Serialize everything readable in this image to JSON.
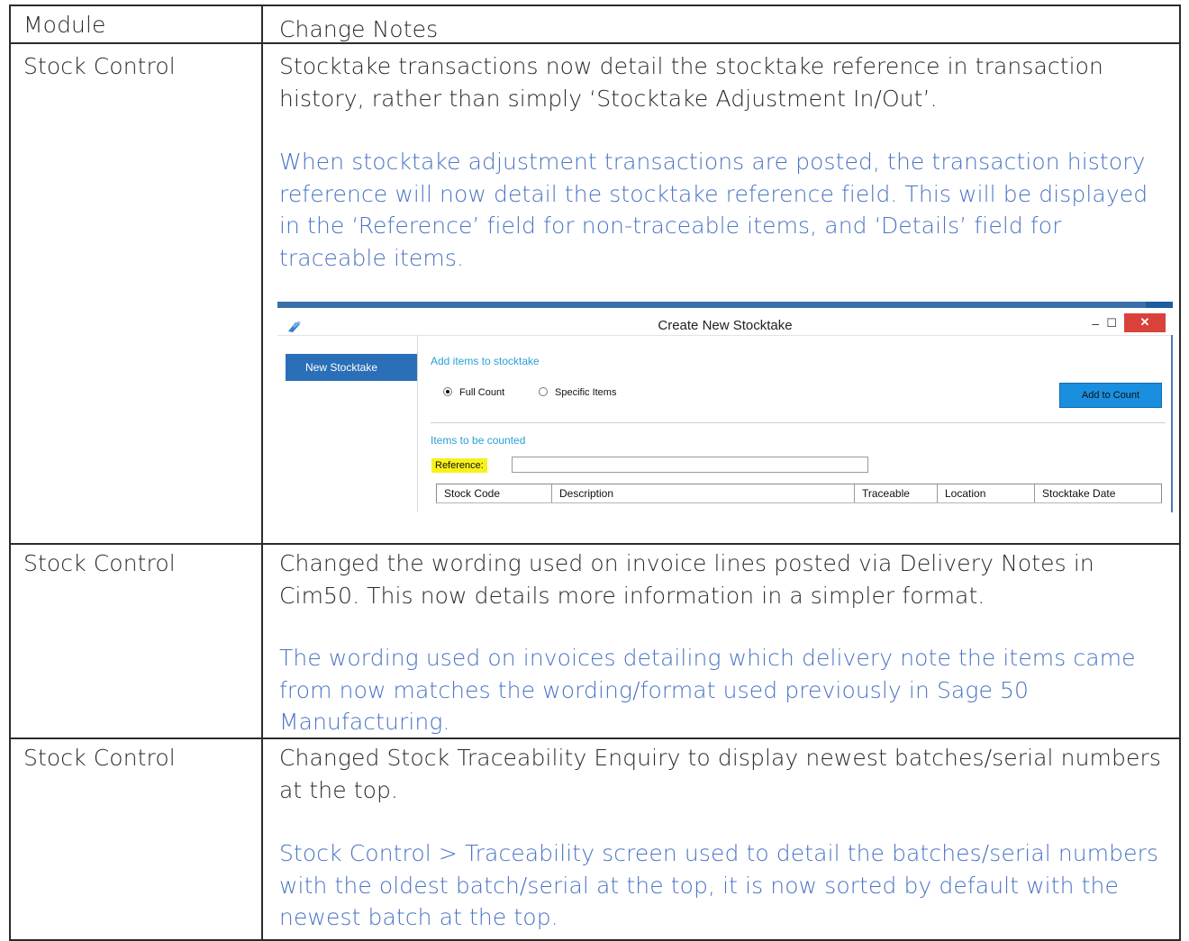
{
  "table": {
    "header": {
      "module": "Module",
      "notes": "Change Notes"
    },
    "rows": [
      {
        "module": "Stock Control",
        "summary": "Stocktake transactions now detail the stocktake reference in transaction history, rather than simply ‘Stocktake Adjustment In/Out’.",
        "detail": "When stocktake adjustment transactions are posted, the transaction history reference will now detail the stocktake reference field. This will be displayed in the ‘Reference’ field for non-traceable items, and ‘Details’ field for traceable items."
      },
      {
        "module": "Stock Control",
        "summary": "Changed the wording used on invoice lines posted via Delivery Notes in Cim50. This now details more information in a simpler format.",
        "detail": "The wording used on invoices detailing which delivery note the items came from now matches the wording/format used previously in Sage 50 Manufacturing."
      },
      {
        "module": "Stock Control",
        "summary": "Changed Stock Traceability Enquiry to display newest batches/serial numbers at the top.",
        "detail": "Stock Control > Traceability screen used to detail the batches/serial numbers with the oldest batch/serial at the top, it is now sorted by default with the newest batch at the top."
      }
    ]
  },
  "screenshot": {
    "window_title": "Create New Stocktake",
    "minimize": "–",
    "maximize": "☐",
    "close": "✕",
    "sidebar_item": "New Stocktake",
    "section_add": "Add items to stocktake",
    "radio_full": "Full Count",
    "radio_specific": "Specific Items",
    "add_button": "Add to Count",
    "section_items": "Items to be counted",
    "reference_label": "Reference:",
    "reference_value": "",
    "columns": [
      "Stock Code",
      "Description",
      "Traceable",
      "Location",
      "Stocktake Date"
    ],
    "colors": {
      "title_bar_accent": "#3b6fa8",
      "sidebar_selected": "#2a6fb8",
      "add_button": "#1a8fe0",
      "section_text": "#2aa0d8",
      "highlight": "#f7f21a",
      "close": "#d9423a"
    }
  },
  "colors": {
    "detail_text": "#4a74c4",
    "border": "#2b2b2b"
  }
}
